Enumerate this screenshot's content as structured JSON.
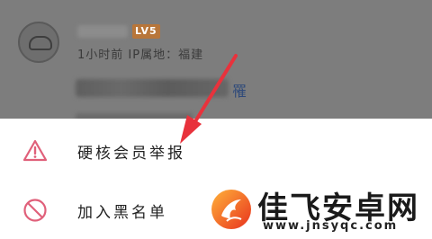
{
  "background": {
    "level_badge": "LV5",
    "meta_line": "1小时前 IP属地：福建",
    "comment_tail": "罹",
    "dim_color": "#7d7d7d"
  },
  "sheet": {
    "items": [
      {
        "label": "硬核会员举报",
        "icon": "warning-triangle-icon",
        "icon_color": "#e0607a"
      },
      {
        "label": "加入黑名单",
        "icon": "prohibited-icon",
        "icon_color": "#e0607a"
      }
    ]
  },
  "annotation": {
    "arrow_color": "#e8323c"
  },
  "watermark": {
    "title": "佳飞安卓网",
    "url": "www.jnsyqc.com"
  }
}
